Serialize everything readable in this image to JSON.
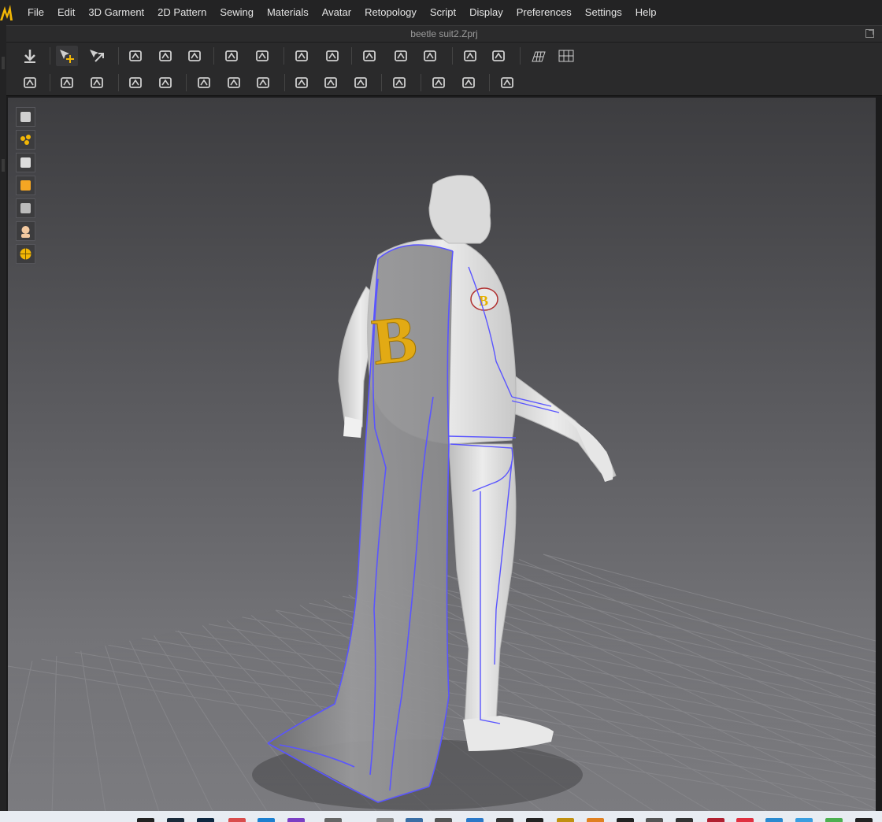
{
  "app": {
    "logo_icon": "app-logo-icon",
    "accent_color": "#f2b705"
  },
  "menu": {
    "items": [
      "File",
      "Edit",
      "3D Garment",
      "2D Pattern",
      "Sewing",
      "Materials",
      "Avatar",
      "Retopology",
      "Script",
      "Display",
      "Preferences",
      "Settings",
      "Help"
    ]
  },
  "document": {
    "title": "beetle suit2.Zprj"
  },
  "toolbar_top": {
    "icons": [
      "download-arrow-icon",
      "move-select-icon",
      "transform-gizmo-icon",
      "rotate-pattern-icon",
      "scale-pattern-icon",
      "fold-arrange-icon",
      "pin-icon",
      "tack-icon",
      "line-draw-icon",
      "segment-sew-icon",
      "pattern-flatten-icon",
      "shirt-front-icon",
      "shirt-back-icon",
      "layer-stack-icon",
      "layer-merge-icon",
      "grid-perspective-icon",
      "grid-flat-icon"
    ]
  },
  "toolbar_bottom": {
    "icons": [
      "avatar-walk-icon",
      "select-mesh-icon",
      "edit-mesh-icon",
      "edit-curve-icon",
      "cut-line-icon",
      "fold-tool-icon",
      "pleat-icon",
      "garment-icon",
      "button-attach-icon",
      "button-icon",
      "lock-button-icon",
      "zipper-icon",
      "trim-icon",
      "puckering-icon",
      "measure-icon"
    ]
  },
  "side_tools": {
    "icons": [
      "garment-view-icon",
      "points-view-icon",
      "avatar-view-icon",
      "texture-view-icon",
      "surface-view-icon",
      "avatar-head-icon",
      "globe-grid-icon"
    ]
  },
  "viewport": {
    "garment_letter": "B",
    "badge_letter": "B",
    "background_color": "#5c5c60",
    "avatar_color": "#dedede",
    "cape_color": "#8c8c8c",
    "seam_color": "#5a55ff"
  }
}
